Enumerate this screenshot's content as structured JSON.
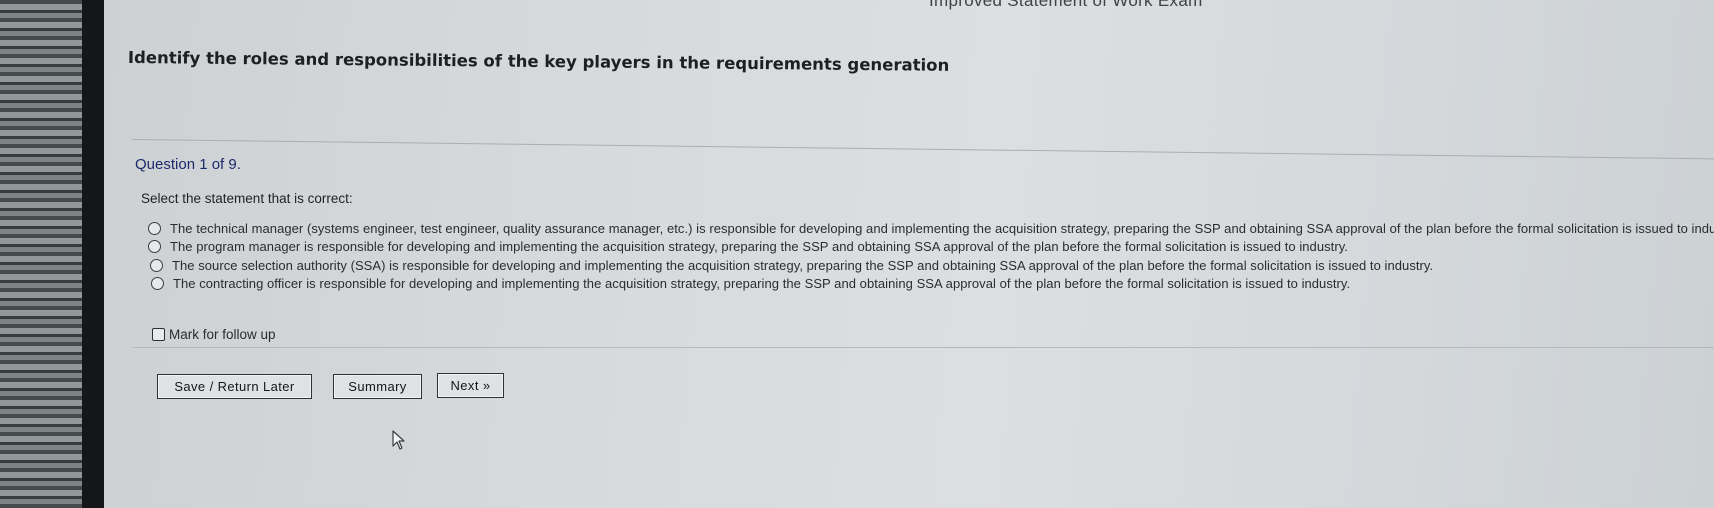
{
  "exam": {
    "title_fragment": "Improved Statement of Work Exam"
  },
  "lesson": {
    "heading": "Identify the roles and responsibilities of the key players in the requirements generation"
  },
  "question": {
    "number_text": "Question 1 of 9.",
    "prompt": "Select the statement that is correct:",
    "options": [
      {
        "text": "The technical manager (systems engineer, test engineer, quality assurance manager, etc.) is responsible for developing and implementing the acquisition strategy, preparing the SSP and obtaining SSA approval of the plan before the formal solicitation is issued to industr"
      },
      {
        "text": "The program manager is responsible for developing and implementing the acquisition strategy, preparing the SSP and obtaining SSA approval of the plan before the formal solicitation is issued to industry."
      },
      {
        "text": "The source selection authority (SSA) is responsible for developing and implementing the acquisition strategy, preparing the SSP and obtaining SSA approval of the plan before the formal solicitation is issued to industry."
      },
      {
        "text": "The contracting officer is responsible for developing and implementing the acquisition strategy, preparing the SSP and obtaining SSA approval of the plan before the formal solicitation is issued to industry."
      }
    ],
    "mark_label": "Mark for follow up"
  },
  "buttons": {
    "save": "Save / Return Later",
    "summary": "Summary",
    "next": "Next »"
  },
  "icons": {
    "radio": "radio-icon",
    "checkbox": "checkbox-icon",
    "cursor": "mouse-pointer-icon"
  }
}
